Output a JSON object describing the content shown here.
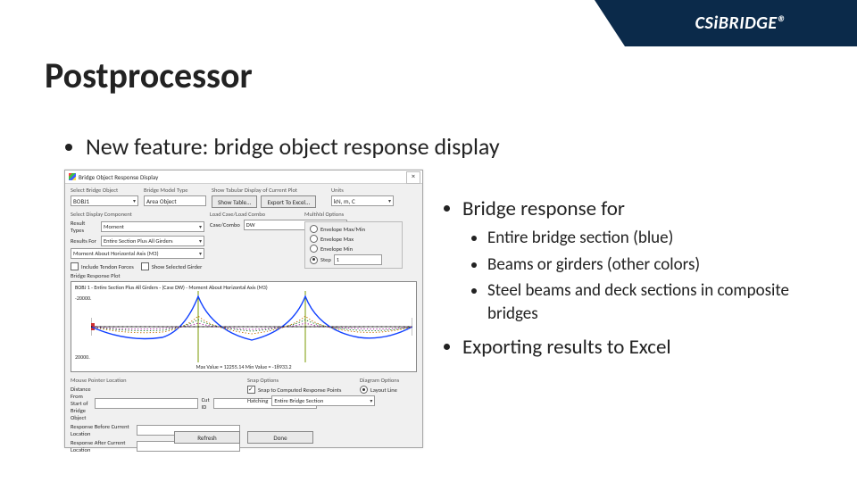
{
  "brand": "CSiBRIDGE®",
  "slide": {
    "title": "Postprocessor",
    "root_bullet": "New feature: bridge object response display",
    "right": {
      "heading": "Bridge response for",
      "sub": [
        "Entire bridge section (blue)",
        "Beams or girders (other colors)",
        "Steel beams and deck sections in composite bridges"
      ],
      "export": "Exporting results to Excel"
    }
  },
  "dialog": {
    "title": "Bridge Object Response Display",
    "close": "×",
    "top": {
      "select_bridge_label": "Select Bridge Object",
      "select_bridge_value": "BOBJ1",
      "model_type_label": "Bridge Model Type",
      "model_type_value": "Area Object",
      "tabular_label": "Show Tabular Display of Current Plot",
      "show_table_btn": "Show Table...",
      "export_excel_btn": "Export To Excel...",
      "units_label": "Units",
      "units_value": "kN, m, C"
    },
    "disp_comp": {
      "section": "Select Display Component",
      "result_type_label": "Result Types",
      "result_type_value": "Moment",
      "results_for_label": "Results For",
      "results_for_value": "Entire Section Plus All Girders",
      "axis_label": "Moment About Horizontal Axis (M3)",
      "include_tendon": "Include Tendon Forces",
      "show_selected": "Show Selected Girder"
    },
    "load": {
      "section": "Load Case/Load Combo",
      "casecombo_label": "Case/Combo",
      "casecombo_value": "DW"
    },
    "multival": {
      "section": "MultiVal Options",
      "env_maxmin": "Envelope Max/Min",
      "env_max": "Envelope Max",
      "env_min": "Envelope Min",
      "step_label": "Step",
      "step_value": "1"
    },
    "plot": {
      "section": "Bridge Response Plot",
      "title": "BOBJ 1 - Entire Section Plus All Girders - (Case DW) - Moment About Horizontal Axis (M3)",
      "y_top": "-20000.",
      "y_bot": "20000.",
      "mouse": "Max Value = 12255.14   Min Value = -18933.2"
    },
    "mouse_loc": {
      "section": "Mouse Pointer Location",
      "dist_label": "Distance From Start of Bridge Object",
      "dist_value": "",
      "cut_label": "Cut ID",
      "cut_value": "",
      "before_label": "Response Before Current Location",
      "before_value": "",
      "after_label": "Response After Current Location",
      "after_value": ""
    },
    "snap": {
      "section": "Snap Options",
      "snap_points": "Snap to Computed Response Points",
      "hatching_label": "Hatching",
      "hatching_value": "Entire Bridge Section"
    },
    "diagram": {
      "section": "Diagram Options",
      "layout_line": "Layout Line"
    },
    "buttons": {
      "refresh": "Refresh",
      "done": "Done"
    }
  }
}
